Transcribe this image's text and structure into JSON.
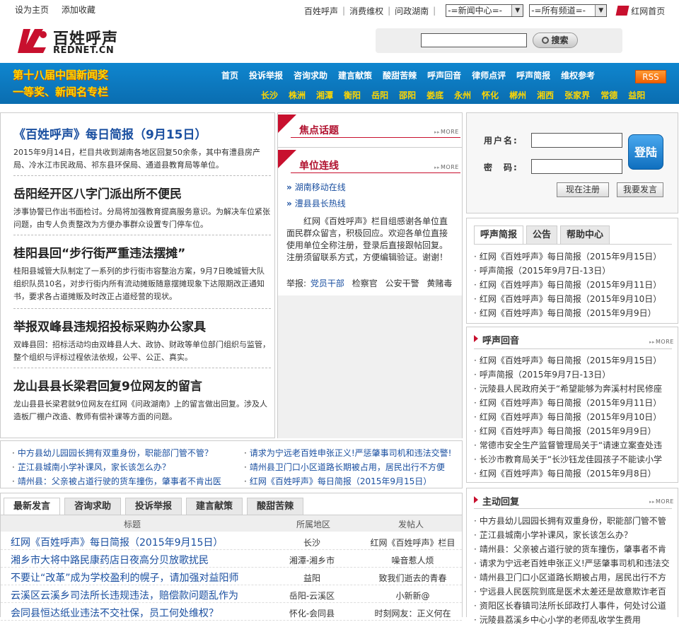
{
  "topbar": {
    "set_home": "设为主页",
    "add_fav": "添加收藏",
    "links": [
      "百姓呼声",
      "消费维权",
      "问政湖南"
    ],
    "select1": "-=新闻中心=-",
    "select2": "-=所有频道=-",
    "home_link": "红网首页"
  },
  "logo": {
    "cn": "百姓呼声",
    "en": "REDNET.CN"
  },
  "search": {
    "button": "搜索"
  },
  "nav": {
    "banner_line1": "第十八届中国新闻奖",
    "banner_line2": "一等奖、新闻名专栏",
    "row1": [
      "首页",
      "投诉举报",
      "咨询求助",
      "建言献策",
      "酸甜苦辣",
      "呼声回音",
      "律师点评",
      "呼声简报",
      "维权参考"
    ],
    "row2": [
      "长沙",
      "株洲",
      "湘潭",
      "衡阳",
      "岳阳",
      "邵阳",
      "娄底",
      "永州",
      "怀化",
      "郴州",
      "湘西",
      "张家界",
      "常德",
      "益阳"
    ],
    "rss": "RSS"
  },
  "stories": [
    {
      "title": "《百姓呼声》每日简报（9月15日）",
      "desc": "2015年9月14日，栏目共收到湖南各地区回复50余条，其中有澧县房产局、冷水江市民政局、祁东县环保局、通道县教育局等单位。"
    },
    {
      "title": "岳阳经开区八字门派出所不便民",
      "desc": "涉事协警已作出书面检讨。分局将加强教育提高服务意识。为解决车位紧张问题，由专人负责整改为方便办事群众设置专门停车位。"
    },
    {
      "title": "桂阳县回“步行街严重违法摆摊”",
      "desc": "桂阳县城管大队制定了一系列的步行街市容整治方案，9月7日晚城管大队组织队员10名，对步行街内所有流动摊贩随意摆摊现象下达限期改正通知书，要求各占道摊贩及时改正占道经营的现状。"
    },
    {
      "title": "举报双峰县违规招投标采购办公家具",
      "desc": "双峰县回：招标活动均由双峰县人大、政协、财政等单位部门组织与监管，整个组织与评标过程依法依规，公平、公正、真实。"
    },
    {
      "title": "龙山县县长梁君回复9位网友的留言",
      "desc": "龙山县县长梁君就9位网友在红网《问政湖南》上的留言做出回复。涉及人造板厂棚户改造、教师有偿补课等方面的问题。"
    }
  ],
  "mid": {
    "focus_title": "焦点话题",
    "unit_title": "单位连线",
    "more": "MORE",
    "links": [
      "湖南移动在线",
      "澧县县长热线"
    ],
    "para": "红网《百姓呼声》栏目组感谢各单位直面民群众留言，积极回应。欢迎各单位直接使用单位全称注册，登录后直接跟帖回复。注册须留联系方式，方便编辑验证。谢谢！",
    "jubao_label": "举报:",
    "jubao_items": [
      "党员干部",
      "检察官",
      "公安干警",
      "黄赌毒"
    ]
  },
  "login": {
    "user_label": "用户名:",
    "pass_label": "密　码:",
    "login_btn": "登陆",
    "register_btn": "现在注册",
    "post_btn": "我要发言"
  },
  "right_tabs": {
    "tabs": [
      "呼声简报",
      "公告",
      "帮助中心"
    ],
    "items": [
      "红网《百姓呼声》每日简报（2015年9月15日）",
      "呼声简报（2015年9月7日-13日）",
      "红网《百姓呼声》每日简报（2015年9月11日）",
      "红网《百姓呼声》每日简报（2015年9月10日）",
      "红网《百姓呼声》每日简报（2015年9月9日）"
    ]
  },
  "echo": {
    "title": "呼声回音",
    "items": [
      "红网《百姓呼声》每日简报（2015年9月15日）",
      "呼声简报（2015年9月7日-13日）",
      "沅陵县人民政府关于“希望能够为奔溪村村民修座",
      "红网《百姓呼声》每日简报（2015年9月11日）",
      "红网《百姓呼声》每日简报（2015年9月10日）",
      "红网《百姓呼声》每日简报（2015年9月9日）",
      "常德市安全生产监督管理局关于“请速立案查处违",
      "长沙市教育局关于“长沙钰龙佳园孩子不能读小学",
      "红网《百姓呼声》每日简报（2015年9月8日）"
    ]
  },
  "active": {
    "title": "主动回复",
    "items": [
      "中方县幼儿园园长拥有双重身份，职能部门管不管",
      "芷江县城南小学补课风，家长该怎么办？",
      "靖州县：父亲被占道行驶的货车撞伤，肇事者不肯",
      "请求为宁远老百姓申张正义!严惩肇事司机和违法交",
      "靖州县卫门口小区道路长期被占用，居民出行不方",
      "宁远县人民医院到底是医术太差还是故意欺诈老百",
      "资阳区长春镇司法所长邱政打人事件，何处讨公道",
      "沅陵县荔溪乡中心小学的老师乱收学生费用"
    ]
  },
  "strip": [
    "中方县幼儿园园长拥有双重身份，职能部门管不管？",
    "请求为宁远老百姓申张正义!严惩肇事司机和违法交警!",
    "芷江县城南小学补课风，家长该怎么办？",
    "靖州县卫门口小区道路长期被占用，居民出行不方便",
    "靖州县：父亲被占道行驶的货车撞伤，肇事者不肯出医",
    "红网《百姓呼声》每日简报（2015年9月15日）"
  ],
  "bottom": {
    "tabs": [
      "最新发言",
      "咨询求助",
      "投诉举报",
      "建言献策",
      "酸甜苦辣"
    ],
    "headers": [
      "标题",
      "所属地区",
      "发帖人"
    ],
    "rows": [
      {
        "title": "红网《百姓呼声》每日简报（2015年9月15日）",
        "region": "长沙",
        "poster": "红网《百姓呼声》栏目"
      },
      {
        "title": "湘乡市大将中路民康药店日夜高分贝放歌扰民",
        "region": "湘潭-湘乡市",
        "poster": "噪音惹人烦"
      },
      {
        "title": "不要让“改革”成为学校盈利的幌子，请加强对益阳师",
        "region": "益阳",
        "poster": "致我们逝去的青春"
      },
      {
        "title": "云溪区云溪乡司法所长违规违法，赔偿款问题乱作为",
        "region": "岳阳-云溪区",
        "poster": "小新新@"
      },
      {
        "title": "会同县恒达纸业违法不交社保，员工何处维权？",
        "region": "怀化-会同县",
        "poster": "时刻网友：正义何在"
      }
    ]
  }
}
